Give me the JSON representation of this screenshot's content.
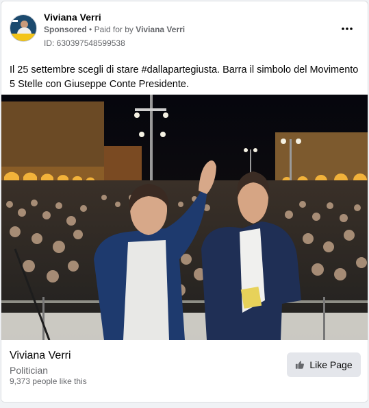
{
  "ad": {
    "advertiser_name": "Viviana Verri",
    "sponsored_label": "Sponsored",
    "separator": "•",
    "paid_for_prefix": "Paid for by",
    "paid_for_name": "Viviana Verri",
    "ad_id": "ID: 630397548599538",
    "more_icon": "more-options-icon",
    "body_text": "Il 25 settembre scegli di stare #dallapartegiusta. Barra il simbolo del Movimento 5 Stelle con Giuseppe Conte Presidente."
  },
  "footer": {
    "page_name": "Viviana Verri",
    "category": "Politician",
    "likes_text": "9,373 people like this",
    "like_button_label": "Like Page",
    "like_icon": "thumbs-up-icon"
  },
  "colors": {
    "primary_text": "#050505",
    "secondary_text": "#65676b",
    "button_bg": "#e4e6eb",
    "card_bg": "#ffffff"
  }
}
